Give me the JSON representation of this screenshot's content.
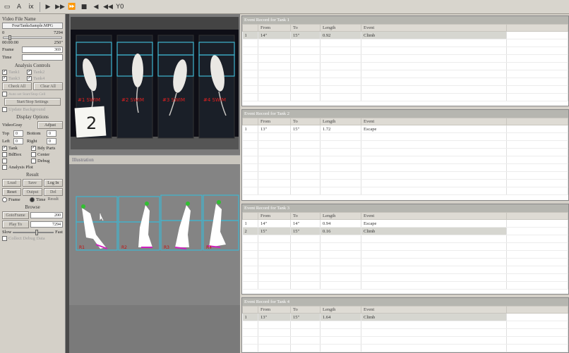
{
  "toolbar": {
    "icons": [
      "file-icon",
      "text-tool-icon",
      "image-icon",
      "play-icon",
      "step-forward-icon",
      "fast-forward-icon",
      "stop-icon",
      "step-back-icon",
      "rewind-icon",
      "clip-icon"
    ],
    "text_glyphs": [
      "A",
      "ⅸ",
      "▶",
      "▶▶",
      "⏩",
      "■",
      "◀",
      "◀◀",
      "Y0"
    ]
  },
  "left": {
    "video_file_label": "Video File Name",
    "video_file_value": "FourTanksSample.MPG",
    "frame_min": "0",
    "frame_max": "7294",
    "time_start": "00:00:00",
    "time_end": "250\"",
    "frame_label": "Frame",
    "frame_value": "369",
    "time_label": "Time",
    "time_value": "",
    "analysis_label": "Analysis Controls",
    "tanks": [
      "Tank1",
      "Tank2",
      "Tank3",
      "Tank4"
    ],
    "check_all": "Check All",
    "clear_all": "Clear All",
    "auto_label": "Auto set Start/Stop Cell",
    "startstop_btn": "Start/Stop Settings",
    "update_bg": "Update Background",
    "display_label": "Display Options",
    "video_gray": "VideoGray",
    "adjust": "Adjust",
    "top_label": "Top",
    "top_val": "0",
    "bottom_label": "Bottom",
    "bottom_val": "0",
    "left_label": "Left",
    "left_val": "0",
    "right_label": "Right",
    "right_val": "0",
    "opt_tank": "Tank",
    "opt_body": "Bdy Parts",
    "opt_bbox": "BdBox",
    "opt_center": "Center",
    "opt_blank": "",
    "opt_debug": "Debug",
    "opt_analysis": "Analysis Plot",
    "result_label": "Result",
    "result_btns": [
      "Load",
      "Save",
      "Log In",
      "Reset",
      "Output",
      "Del Result"
    ],
    "frame_opt": "Frame",
    "time_opt": "Time",
    "browse_label": "Browse",
    "goto_btn": "GotoFrame",
    "goto_val": "200",
    "play_btn": "Play To",
    "play_val": "7294",
    "slow_label": "Slow",
    "fast_label": "Fast",
    "collect_label": "Collect Debug Data"
  },
  "video": {
    "tank_labels": [
      "#1 SWIM",
      "#2 SWIM",
      "#3 SWIM",
      "#4 SWIM"
    ],
    "card_text": "2"
  },
  "illus": {
    "title": "Illustration",
    "marks": [
      "R1",
      "R2",
      "R3",
      "R4"
    ]
  },
  "panels": [
    {
      "title": "Event Record for Tank 1",
      "cols": [
        "",
        "From",
        "To",
        "Length",
        "Event"
      ],
      "rows": [
        [
          "1",
          "14\"",
          "15\"",
          "0.92",
          "Climb"
        ]
      ],
      "selected": 0
    },
    {
      "title": "Event Record for Tank 2",
      "cols": [
        "",
        "From",
        "To",
        "Length",
        "Event"
      ],
      "rows": [
        [
          "1",
          "13\"",
          "15\"",
          "1.72",
          "Escape"
        ]
      ],
      "selected": -1
    },
    {
      "title": "Event Record for Tank 3",
      "cols": [
        "",
        "From",
        "To",
        "Length",
        "Event"
      ],
      "rows": [
        [
          "1",
          "14\"",
          "14\"",
          "0.94",
          "Escape"
        ],
        [
          "2",
          "15\"",
          "15\"",
          "0.16",
          "Climb"
        ]
      ],
      "selected": 1
    },
    {
      "title": "Event Record for Tank 4",
      "cols": [
        "",
        "From",
        "To",
        "Length",
        "Event"
      ],
      "rows": [
        [
          "1",
          "13\"",
          "15\"",
          "1.64",
          "Climb"
        ]
      ],
      "selected": 0
    }
  ],
  "colors": {
    "tank_box": "#3fb6d0",
    "label_red": "#e02020",
    "mark_magenta": "#d020c0",
    "mouse_green": "#30c030"
  }
}
